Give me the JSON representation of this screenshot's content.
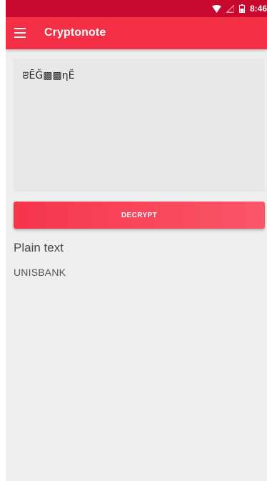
{
  "status_bar": {
    "time": "8:46",
    "icons": [
      "wifi-icon",
      "signal-icon",
      "battery-icon"
    ]
  },
  "app_bar": {
    "title": "Cryptonote",
    "menu_icon": "menu-icon"
  },
  "editor": {
    "cipher_text": "ꢂĒĞ▩▩ηĔ"
  },
  "actions": {
    "decrypt_label": "DECRYPT"
  },
  "result": {
    "label": "Plain text",
    "value": "UNISBANK"
  },
  "colors": {
    "status_bar": "#c8082c",
    "app_bar": "#f22f45",
    "accent": "#f22f45",
    "background": "#eeeeee"
  }
}
